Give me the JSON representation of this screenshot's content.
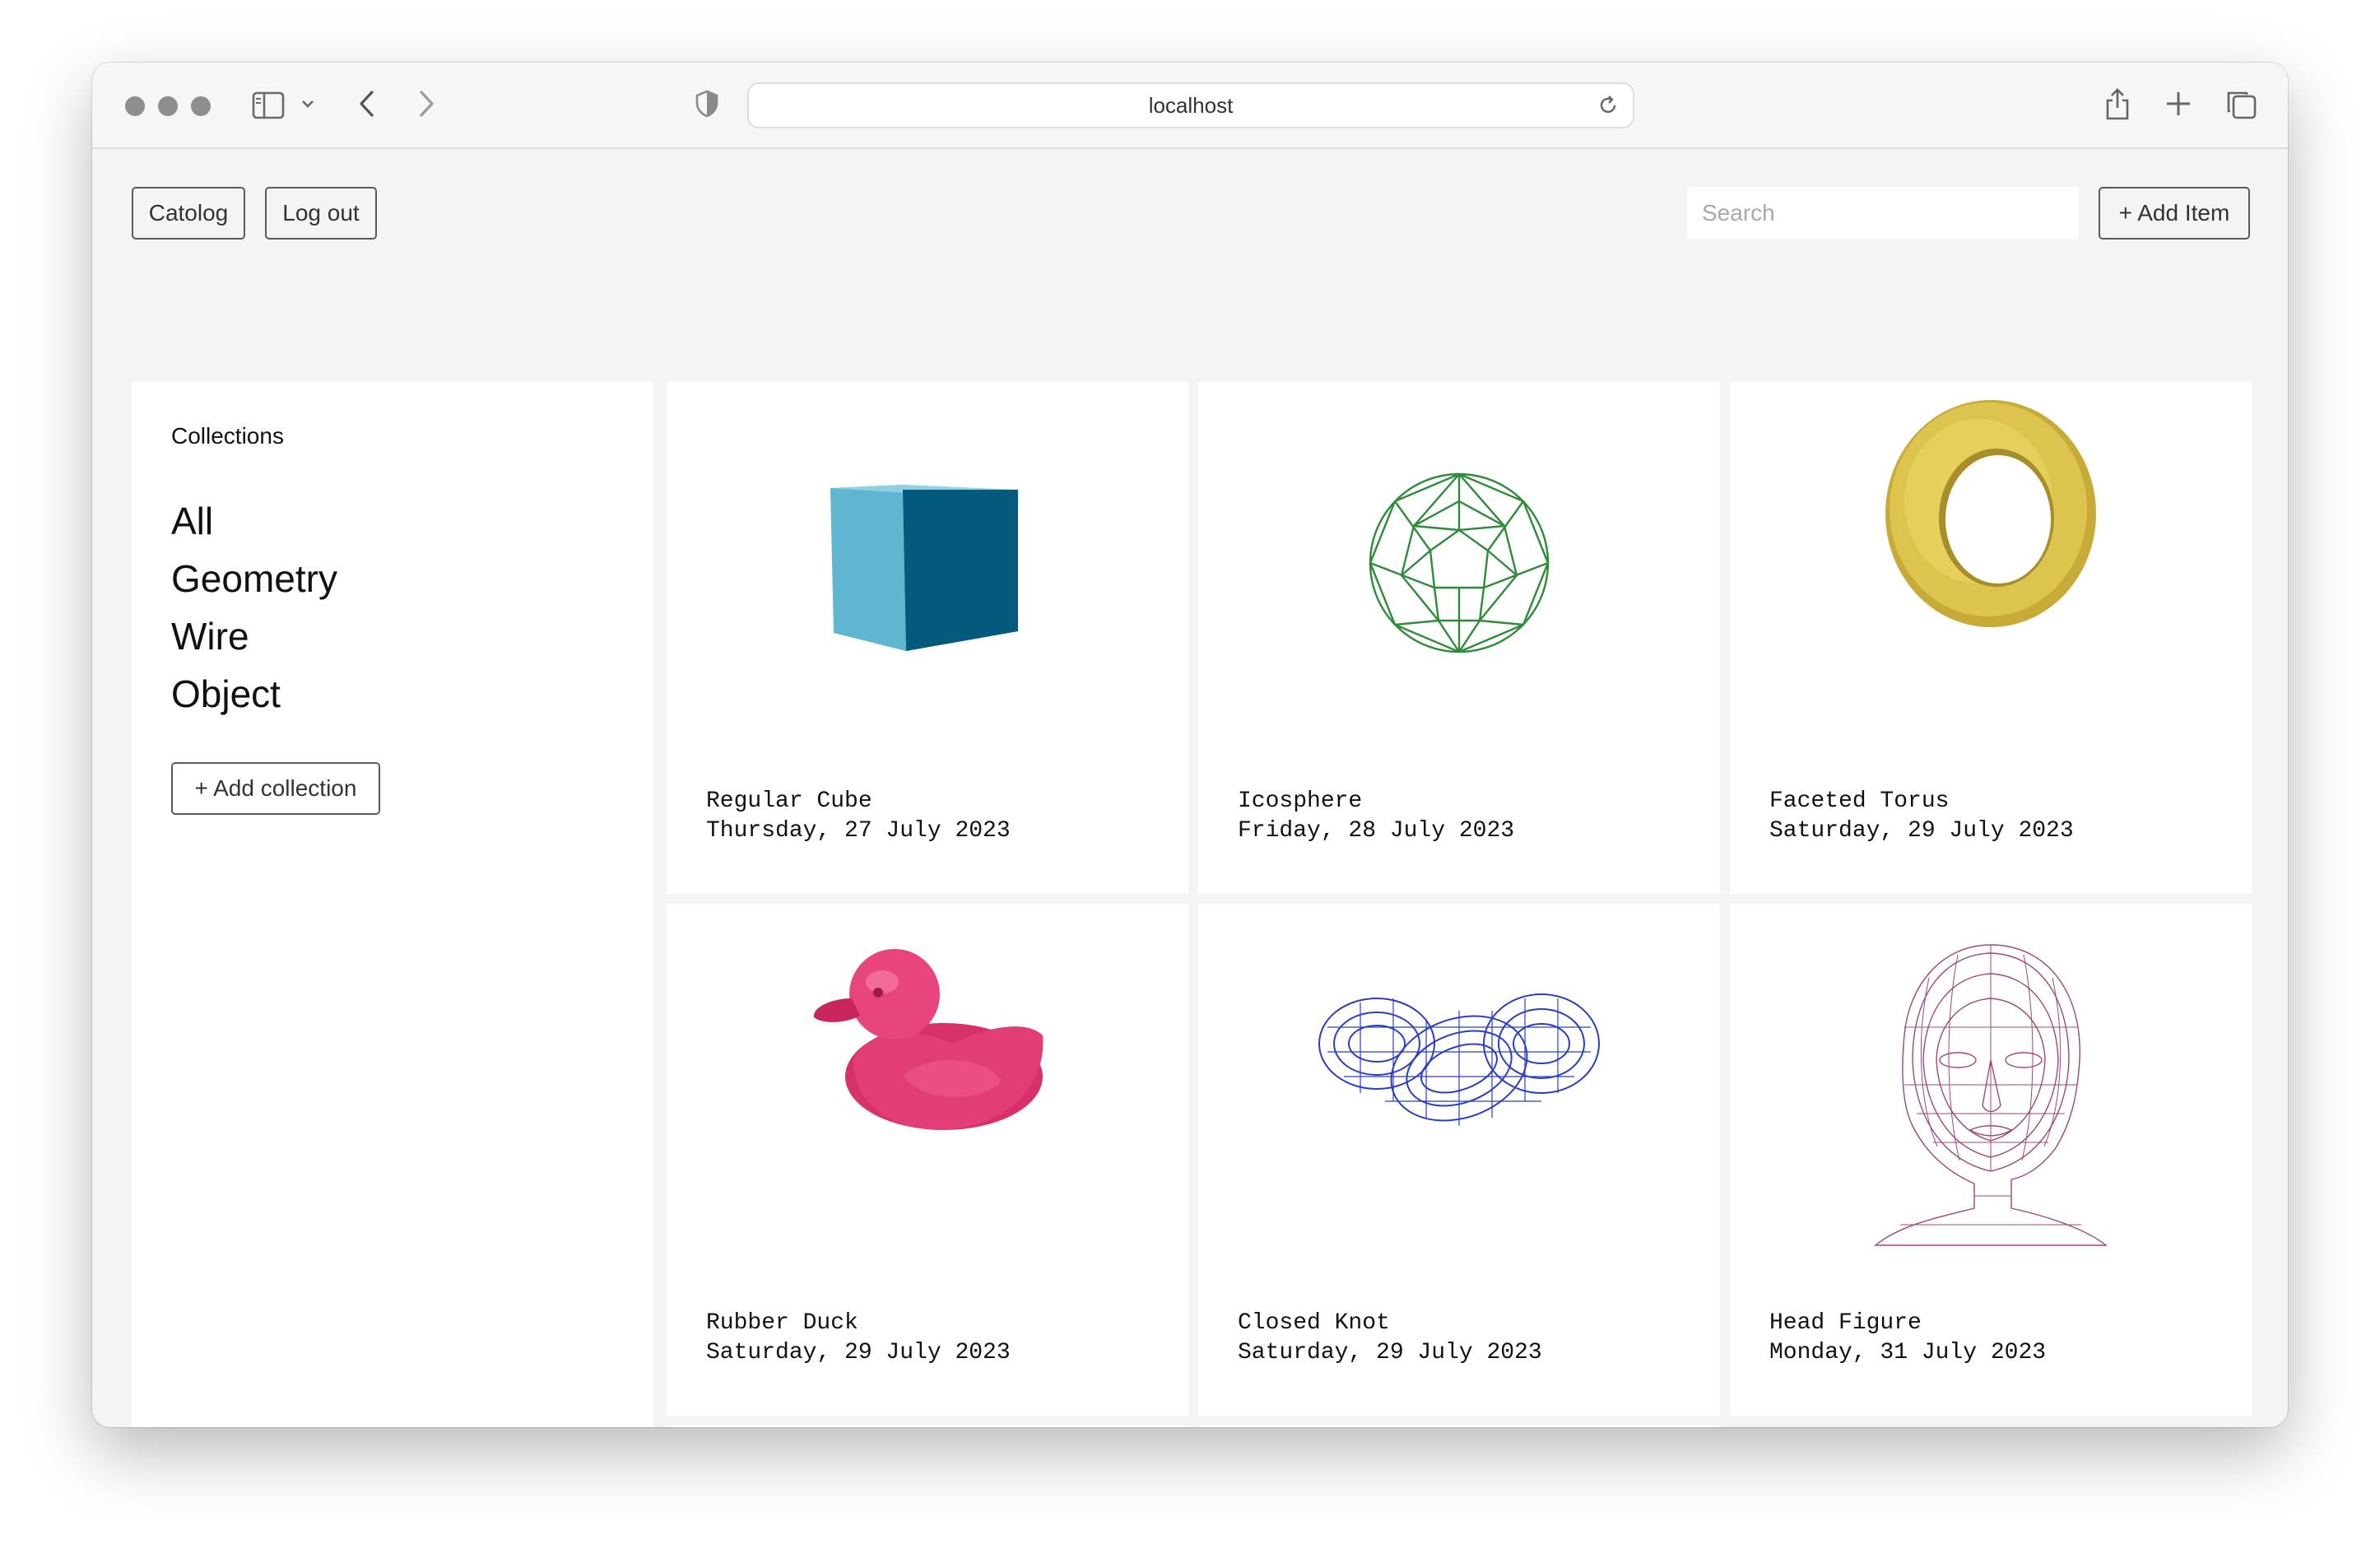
{
  "browser": {
    "url": "localhost"
  },
  "nav": {
    "catalog_label": "Catolog",
    "logout_label": "Log out",
    "search_placeholder": "Search",
    "add_item_label": "+ Add Item"
  },
  "sidebar": {
    "heading": "Collections",
    "collections": [
      "All",
      "Geometry",
      "Wire",
      "Object"
    ],
    "add_collection_label": "+ Add collection"
  },
  "items": [
    {
      "title": "Regular Cube",
      "date": "Thursday, 27 July 2023",
      "thumbnail": "blue-cube-render"
    },
    {
      "title": "Icosphere",
      "date": "Friday, 28 July 2023",
      "thumbnail": "green-wire-icosphere"
    },
    {
      "title": "Faceted Torus",
      "date": "Saturday, 29 July 2023",
      "thumbnail": "yellow-torus-render"
    },
    {
      "title": "Rubber Duck",
      "date": "Saturday, 29 July 2023",
      "thumbnail": "pink-duck-render"
    },
    {
      "title": "Closed Knot",
      "date": "Saturday, 29 July 2023",
      "thumbnail": "blue-wire-knot"
    },
    {
      "title": "Head Figure",
      "date": "Monday, 31 July 2023",
      "thumbnail": "purple-wire-head"
    }
  ],
  "colors": {
    "page_bg": "#f4f4f4",
    "card_bg": "#ffffff",
    "cube_light": "#5fb6d1",
    "cube_dark": "#035a7c",
    "icosphere": "#2e8b3a",
    "torus": "#d9c24a",
    "duck": "#e23d78",
    "knot": "#2a3fc0",
    "head": "#a0457a"
  }
}
